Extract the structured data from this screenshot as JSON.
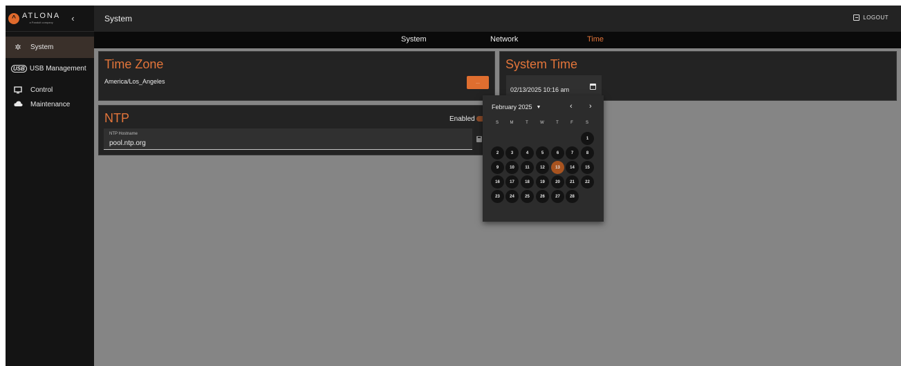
{
  "sidebar": {
    "brand_name": "ATLONA",
    "brand_sub": "a Panduit company",
    "items": [
      {
        "label": "System"
      },
      {
        "label": "USB Management",
        "badge": "USB"
      },
      {
        "label": "Control"
      },
      {
        "label": "Maintenance"
      }
    ]
  },
  "header": {
    "title": "System",
    "logout": "LOGOUT"
  },
  "tabs": [
    {
      "label": "System"
    },
    {
      "label": "Network"
    },
    {
      "label": "Time",
      "active": true
    }
  ],
  "timezone": {
    "title": "Time Zone",
    "value": "America/Los_Angeles",
    "button": "..."
  },
  "ntp": {
    "title": "NTP",
    "enabled_label": "Enabled",
    "enabled": true,
    "hostname_label": "NTP Hostname",
    "hostname": "pool.ntp.org"
  },
  "system_time": {
    "title": "System Time",
    "value": "02/13/2025 10:16 am"
  },
  "calendar": {
    "month_label": "February 2025",
    "weekdays": [
      "S",
      "M",
      "T",
      "W",
      "T",
      "F",
      "S"
    ],
    "selected_day": 13,
    "days": [
      "1",
      "2",
      "3",
      "4",
      "5",
      "6",
      "7",
      "8",
      "9",
      "10",
      "11",
      "12",
      "13",
      "14",
      "15",
      "16",
      "17",
      "18",
      "19",
      "20",
      "21",
      "22",
      "23",
      "24",
      "25",
      "26",
      "27",
      "28"
    ]
  },
  "colors": {
    "accent": "#e3753a",
    "sidebar_bg": "#141414",
    "card_bg": "#232323",
    "content_bg": "#858585"
  }
}
